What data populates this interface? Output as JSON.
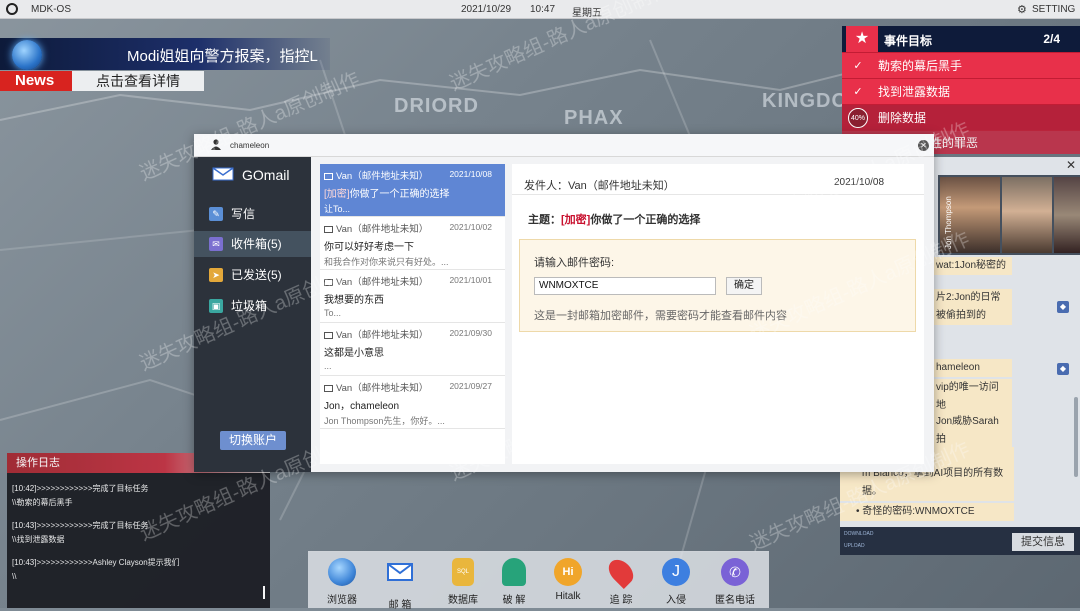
{
  "topbar": {
    "os_name": "MDK-OS",
    "date": "2021/10/29",
    "time": "10:47",
    "weekday": "星期五",
    "setting": "SETTING"
  },
  "map": {
    "regions": [
      "DRIORD",
      "PHAX",
      "KINGDO"
    ]
  },
  "news": {
    "headline": "Modi姐姐向警方报案，指控L",
    "tag": "News",
    "link": "点击查看详情"
  },
  "tasks": {
    "title": "事件目标",
    "count": "2/4",
    "items": [
      {
        "label": "勒索的幕后黑手",
        "status": "done"
      },
      {
        "label": "找到泄露数据",
        "status": "done"
      },
      {
        "label": "删除数据",
        "status": "active",
        "progress": "40%"
      },
      {
        "label": "性的罪恶",
        "status": "pending"
      }
    ]
  },
  "right_panel": {
    "photo_label": "Jon Thompson",
    "cards": [
      "wat:1Jon秘密的",
      "片2:Jon的日常照",
      "被偷拍到的",
      "hameleon",
      "vip的唯一访问地",
      "Jon威胁Sarah拍",
      "让Jon去勒索To",
      "m Blanco，拿到AI项目的所有数",
      "据。",
      "奇怪的密码:WNMOXTCE"
    ],
    "download_label": "DOWNLOAD",
    "upload_label": "UPLOAD",
    "submit": "提交信息"
  },
  "log": {
    "title": "操作日志",
    "entries": [
      "[10:42]>>>>>>>>>>>>完成了目标任务",
      "\\\\勒索的幕后黑手",
      "[10:43]>>>>>>>>>>>>完成了目标任务",
      "\\\\找到泄露数据",
      "[10:43]>>>>>>>>>>>>Ashley Clayson提示我们",
      "\\\\"
    ]
  },
  "gomail": {
    "user": "chameleon",
    "app_name": "GOmail",
    "menu": [
      {
        "label": "写信",
        "icon": "pencil-icon",
        "color": "#5b8fd6"
      },
      {
        "label": "收件箱(5)",
        "icon": "inbox-icon",
        "color": "#7b6fd0"
      },
      {
        "label": "已发送(5)",
        "icon": "send-icon",
        "color": "#e3a83a"
      },
      {
        "label": "垃圾箱",
        "icon": "trash-icon",
        "color": "#3aa7a0"
      }
    ],
    "switch_account": "切换账户",
    "emails": [
      {
        "sender": "Van（邮件地址未知）",
        "date": "2021/10/08",
        "tag": "[加密]",
        "subject": "你做了一个正确的选择",
        "preview": "让To..."
      },
      {
        "sender": "Van（邮件地址未知）",
        "date": "2021/10/02",
        "tag": "",
        "subject": "你可以好好考虑一下",
        "preview": "和我合作对你来说只有好处。..."
      },
      {
        "sender": "Van（邮件地址未知）",
        "date": "2021/10/01",
        "tag": "",
        "subject": "我想要的东西",
        "preview": "To..."
      },
      {
        "sender": "Van（邮件地址未知）",
        "date": "2021/09/30",
        "tag": "",
        "subject": "这都是小意思",
        "preview": "..."
      },
      {
        "sender": "Van（邮件地址未知）",
        "date": "2021/09/27",
        "tag": "",
        "subject": "Jon，chameleon",
        "preview": "Jon Thompson先生，你好。..."
      }
    ],
    "detail": {
      "from": "发件人：Van（邮件地址未知）",
      "date": "2021/10/08",
      "subject_prefix": "主题：",
      "subject_tag": "[加密]",
      "subject": "你做了一个正确的选择",
      "password_label": "请输入邮件密码:",
      "password_value": "WNMOXTCE",
      "confirm": "确定",
      "hint": "这是一封邮箱加密邮件，需要密码才能查看邮件内容"
    }
  },
  "dock": [
    {
      "label": "浏览器",
      "icon": "browser-icon",
      "color": "#3f86d8"
    },
    {
      "label": "邮 箱",
      "icon": "mail-icon",
      "color": "#2f6fd6"
    },
    {
      "label": "数据库",
      "icon": "database-icon",
      "color": "#e9b63c"
    },
    {
      "label": "破 解",
      "icon": "crack-icon",
      "color": "#27a37a"
    },
    {
      "label": "Hitalk",
      "icon": "hitalk-icon",
      "color": "#f0a52a"
    },
    {
      "label": "追 踪",
      "icon": "track-icon",
      "color": "#e23a3a"
    },
    {
      "label": "入侵",
      "icon": "hook-icon",
      "color": "#3d7fe0"
    },
    {
      "label": "匿名电话",
      "icon": "phone-icon",
      "color": "#7a62d6"
    }
  ],
  "watermark": "迷失攻略组-路人a原创制作"
}
